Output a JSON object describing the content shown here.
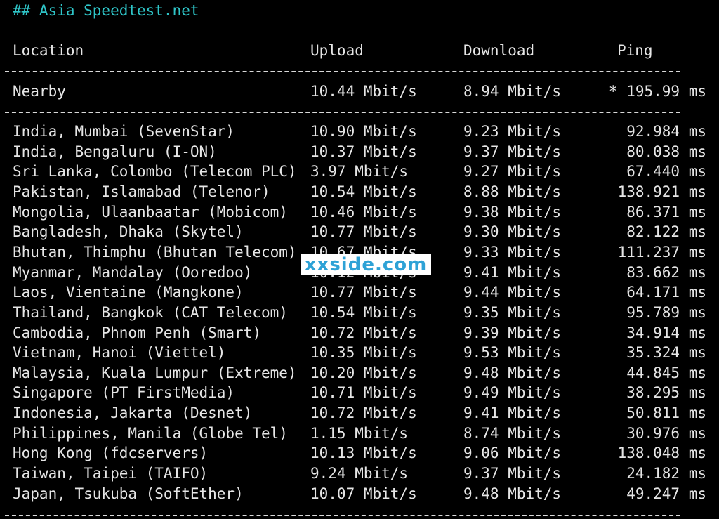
{
  "title": "## Asia Speedtest.net",
  "headers": {
    "location": "Location",
    "upload": "Upload",
    "download": "Download",
    "ping": "Ping"
  },
  "nearby": {
    "location": "Nearby",
    "upload": "10.44 Mbit/s",
    "download": "8.94 Mbit/s",
    "ping": "* 195.99 ms"
  },
  "rows": [
    {
      "location": "India, Mumbai (SevenStar)",
      "upload": "10.90 Mbit/s",
      "download": "9.23 Mbit/s",
      "ping": "92.984 ms"
    },
    {
      "location": "India, Bengaluru (I-ON)",
      "upload": "10.37 Mbit/s",
      "download": "9.37 Mbit/s",
      "ping": "80.038 ms"
    },
    {
      "location": "Sri Lanka, Colombo (Telecom PLC)",
      "upload": "3.97 Mbit/s",
      "download": "9.27 Mbit/s",
      "ping": "67.440 ms"
    },
    {
      "location": "Pakistan, Islamabad (Telenor)",
      "upload": "10.54 Mbit/s",
      "download": "8.88 Mbit/s",
      "ping": "138.921 ms"
    },
    {
      "location": "Mongolia, Ulaanbaatar (Mobicom)",
      "upload": "10.46 Mbit/s",
      "download": "9.38 Mbit/s",
      "ping": "86.371 ms"
    },
    {
      "location": "Bangladesh, Dhaka (Skytel)",
      "upload": "10.77 Mbit/s",
      "download": "9.30 Mbit/s",
      "ping": "82.122 ms"
    },
    {
      "location": "Bhutan, Thimphu (Bhutan Telecom)",
      "upload": "10.67 Mbit/s",
      "download": "9.33 Mbit/s",
      "ping": "111.237 ms"
    },
    {
      "location": "Myanmar, Mandalay (Ooredoo)",
      "upload": "10.12 Mbit/s",
      "download": "9.41 Mbit/s",
      "ping": "83.662 ms"
    },
    {
      "location": "Laos, Vientaine (Mangkone)",
      "upload": "10.77 Mbit/s",
      "download": "9.44 Mbit/s",
      "ping": "64.171 ms"
    },
    {
      "location": "Thailand, Bangkok (CAT Telecom)",
      "upload": "10.54 Mbit/s",
      "download": "9.35 Mbit/s",
      "ping": "95.789 ms"
    },
    {
      "location": "Cambodia, Phnom Penh (Smart)",
      "upload": "10.72 Mbit/s",
      "download": "9.39 Mbit/s",
      "ping": "34.914 ms"
    },
    {
      "location": "Vietnam, Hanoi (Viettel)",
      "upload": "10.35 Mbit/s",
      "download": "9.53 Mbit/s",
      "ping": "35.324 ms"
    },
    {
      "location": "Malaysia, Kuala Lumpur (Extreme)",
      "upload": "10.20 Mbit/s",
      "download": "9.48 Mbit/s",
      "ping": "44.845 ms"
    },
    {
      "location": "Singapore (PT FirstMedia)",
      "upload": "10.71 Mbit/s",
      "download": "9.49 Mbit/s",
      "ping": "38.295 ms"
    },
    {
      "location": "Indonesia, Jakarta (Desnet)",
      "upload": "10.72 Mbit/s",
      "download": "9.41 Mbit/s",
      "ping": "50.811 ms"
    },
    {
      "location": "Philippines, Manila (Globe Tel)",
      "upload": "1.15 Mbit/s",
      "download": "8.74 Mbit/s",
      "ping": "30.976 ms"
    },
    {
      "location": "Hong Kong (fdcservers)",
      "upload": "10.13 Mbit/s",
      "download": "9.06 Mbit/s",
      "ping": "138.048 ms"
    },
    {
      "location": "Taiwan, Taipei (TAIFO)",
      "upload": "9.24 Mbit/s",
      "download": "9.37 Mbit/s",
      "ping": "24.182 ms"
    },
    {
      "location": "Japan, Tsukuba (SoftEther)",
      "upload": "10.07 Mbit/s",
      "download": "9.48 Mbit/s",
      "ping": "49.247 ms"
    }
  ],
  "watermark": "xxside.com",
  "colors": {
    "background": "#000000",
    "text": "#e6e6e6",
    "title": "#2fc6c9",
    "watermark": "#2ea2d6"
  }
}
